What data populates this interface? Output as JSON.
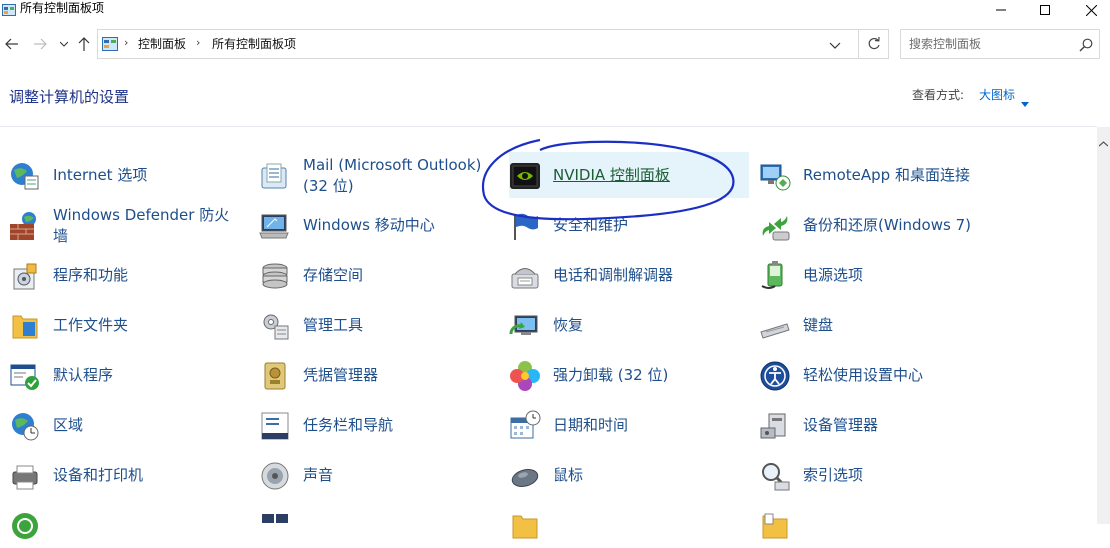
{
  "window": {
    "title": "所有控制面板项"
  },
  "nav": {
    "breadcrumb": [
      "控制面板",
      "所有控制面板项"
    ],
    "search_placeholder": "搜索控制面板"
  },
  "header": {
    "title": "调整计算机的设置",
    "view_by_label": "查看方式:",
    "view_by_value": "大图标"
  },
  "items": [
    {
      "label": "Internet 选项",
      "icon": "internet-options-icon"
    },
    {
      "label": "Mail (Microsoft Outlook)\n(32 位)",
      "icon": "mail-icon"
    },
    {
      "label": "NVIDIA 控制面板",
      "icon": "nvidia-icon"
    },
    {
      "label": "RemoteApp 和桌面连接",
      "icon": "remoteapp-icon"
    },
    {
      "label": "Windows Defender 防火墙",
      "icon": "firewall-icon"
    },
    {
      "label": "Windows 移动中心",
      "icon": "mobility-center-icon"
    },
    {
      "label": "安全和维护",
      "icon": "security-flag-icon"
    },
    {
      "label": "备份和还原(Windows 7)",
      "icon": "backup-icon"
    },
    {
      "label": "程序和功能",
      "icon": "programs-icon"
    },
    {
      "label": "存储空间",
      "icon": "storage-spaces-icon"
    },
    {
      "label": "电话和调制解调器",
      "icon": "phone-modem-icon"
    },
    {
      "label": "电源选项",
      "icon": "power-options-icon"
    },
    {
      "label": "工作文件夹",
      "icon": "work-folders-icon"
    },
    {
      "label": "管理工具",
      "icon": "admin-tools-icon"
    },
    {
      "label": "恢复",
      "icon": "recovery-icon"
    },
    {
      "label": "键盘",
      "icon": "keyboard-icon"
    },
    {
      "label": "默认程序",
      "icon": "default-programs-icon"
    },
    {
      "label": "凭据管理器",
      "icon": "credential-manager-icon"
    },
    {
      "label": "强力卸载 (32 位)",
      "icon": "uninstaller-icon"
    },
    {
      "label": "轻松使用设置中心",
      "icon": "ease-of-access-icon"
    },
    {
      "label": "区域",
      "icon": "region-icon"
    },
    {
      "label": "任务栏和导航",
      "icon": "taskbar-icon"
    },
    {
      "label": "日期和时间",
      "icon": "date-time-icon"
    },
    {
      "label": "设备管理器",
      "icon": "device-manager-icon"
    },
    {
      "label": "设备和打印机",
      "icon": "devices-printers-icon"
    },
    {
      "label": "声音",
      "icon": "sound-icon"
    },
    {
      "label": "鼠标",
      "icon": "mouse-icon"
    },
    {
      "label": "索引选项",
      "icon": "indexing-icon"
    }
  ],
  "colors": {
    "link": "#1e4f8c",
    "hover_bg": "#e5f3fb",
    "annotation": "#1b2fc4",
    "heading": "#1e3287"
  }
}
